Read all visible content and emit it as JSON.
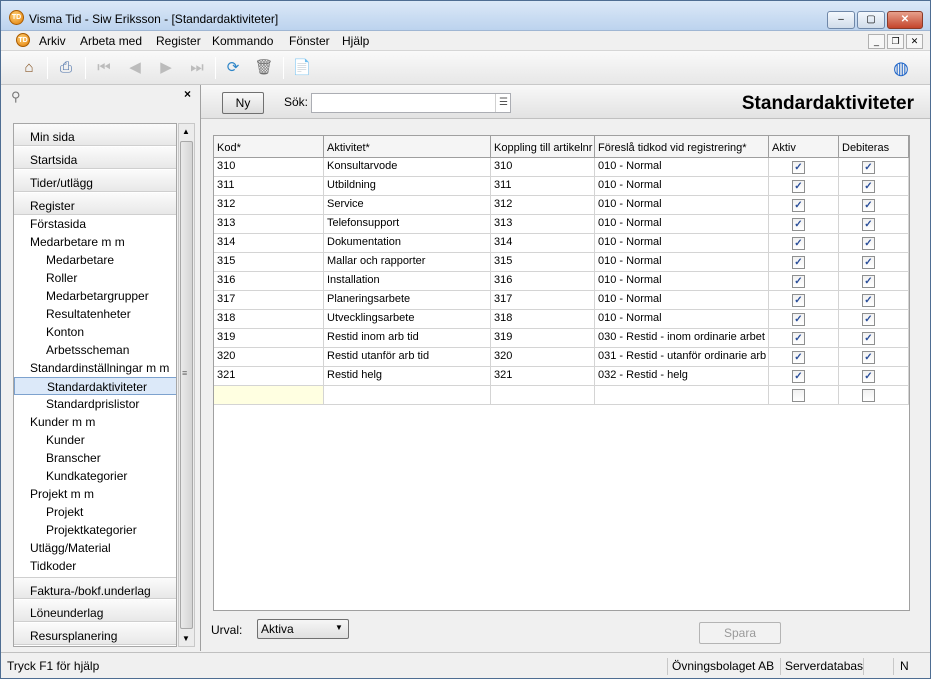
{
  "window": {
    "title": "Visma Tid - Siw Eriksson - [Standardaktiviteter]",
    "icon": "visma-tid-icon"
  },
  "menu": [
    "Arkiv",
    "Arbeta med",
    "Register",
    "Kommando",
    "Fönster",
    "Hjälp"
  ],
  "toolbar": {
    "buttons": [
      "home-icon",
      "print-icon",
      "first-record-icon",
      "previous-record-icon",
      "next-record-icon",
      "last-record-icon",
      "refresh-icon",
      "delete-icon",
      "help-document-icon",
      "web-icon"
    ]
  },
  "nav": {
    "sections_top": [
      "Min sida",
      "Startsida",
      "Tider/utlägg",
      "Register"
    ],
    "items": [
      {
        "label": "Förstasida",
        "level": 1
      },
      {
        "label": "Medarbetare m m",
        "level": 1
      },
      {
        "label": "Medarbetare",
        "level": 2
      },
      {
        "label": "Roller",
        "level": 2
      },
      {
        "label": "Medarbetargrupper",
        "level": 2
      },
      {
        "label": "Resultatenheter",
        "level": 2
      },
      {
        "label": "Konton",
        "level": 2
      },
      {
        "label": "Arbetsscheman",
        "level": 2
      },
      {
        "label": "Standardinställningar m m",
        "level": 1
      },
      {
        "label": "Standardaktiviteter",
        "level": 2,
        "selected": true
      },
      {
        "label": "Standardprislistor",
        "level": 2
      },
      {
        "label": "Kunder m m",
        "level": 1
      },
      {
        "label": "Kunder",
        "level": 2
      },
      {
        "label": "Branscher",
        "level": 2
      },
      {
        "label": "Kundkategorier",
        "level": 2
      },
      {
        "label": "Projekt m m",
        "level": 1
      },
      {
        "label": "Projekt",
        "level": 2
      },
      {
        "label": "Projektkategorier",
        "level": 2
      },
      {
        "label": "Utlägg/Material",
        "level": 1
      },
      {
        "label": "Tidkoder",
        "level": 1
      }
    ],
    "sections_bottom": [
      "Faktura-/bokf.underlag",
      "Löneunderlag",
      "Resursplanering"
    ]
  },
  "header": {
    "new_button": "Ny",
    "search_label": "Sök:",
    "search_value": "",
    "page_title": "Standardaktiviteter"
  },
  "grid": {
    "columns": [
      "Kod*",
      "Aktivitet*",
      "Koppling till artikelnr",
      "Föreslå tidkod vid registrering*",
      "Aktiv",
      "Debiteras"
    ],
    "rows": [
      {
        "kod": "310",
        "aktivitet": "Konsultarvode",
        "artikel": "310",
        "tidkod": "010 - Normal",
        "aktiv": true,
        "debiteras": true
      },
      {
        "kod": "311",
        "aktivitet": "Utbildning",
        "artikel": "311",
        "tidkod": "010 - Normal",
        "aktiv": true,
        "debiteras": true
      },
      {
        "kod": "312",
        "aktivitet": "Service",
        "artikel": "312",
        "tidkod": "010 - Normal",
        "aktiv": true,
        "debiteras": true
      },
      {
        "kod": "313",
        "aktivitet": "Telefonsupport",
        "artikel": "313",
        "tidkod": "010 - Normal",
        "aktiv": true,
        "debiteras": true
      },
      {
        "kod": "314",
        "aktivitet": "Dokumentation",
        "artikel": "314",
        "tidkod": "010 - Normal",
        "aktiv": true,
        "debiteras": true
      },
      {
        "kod": "315",
        "aktivitet": "Mallar och rapporter",
        "artikel": "315",
        "tidkod": "010 - Normal",
        "aktiv": true,
        "debiteras": true
      },
      {
        "kod": "316",
        "aktivitet": "Installation",
        "artikel": "316",
        "tidkod": "010 - Normal",
        "aktiv": true,
        "debiteras": true
      },
      {
        "kod": "317",
        "aktivitet": "Planeringsarbete",
        "artikel": "317",
        "tidkod": "010 - Normal",
        "aktiv": true,
        "debiteras": true
      },
      {
        "kod": "318",
        "aktivitet": "Utvecklingsarbete",
        "artikel": "318",
        "tidkod": "010 - Normal",
        "aktiv": true,
        "debiteras": true
      },
      {
        "kod": "319",
        "aktivitet": "Restid inom arb tid",
        "artikel": "319",
        "tidkod": "030 - Restid - inom ordinarie arbet",
        "aktiv": true,
        "debiteras": true
      },
      {
        "kod": "320",
        "aktivitet": "Restid utanför arb tid",
        "artikel": "320",
        "tidkod": "031 - Restid - utanför ordinarie arb",
        "aktiv": true,
        "debiteras": true
      },
      {
        "kod": "321",
        "aktivitet": "Restid helg",
        "artikel": "321",
        "tidkod": "032 - Restid - helg",
        "aktiv": true,
        "debiteras": true
      },
      {
        "kod": "",
        "aktivitet": "",
        "artikel": "",
        "tidkod": "",
        "aktiv": false,
        "debiteras": false
      }
    ]
  },
  "footer": {
    "urval_label": "Urval:",
    "urval_value": "Aktiva",
    "save_button": "Spara"
  },
  "status": {
    "help": "Tryck F1 för hjälp",
    "company": "Övningsbolaget AB",
    "database": "Serverdatabas",
    "mode": "N"
  },
  "colors": {
    "selected_nav": "#dce9f9",
    "new_row_highlight": "#ffffe1",
    "accent": "#2b4f9a"
  }
}
